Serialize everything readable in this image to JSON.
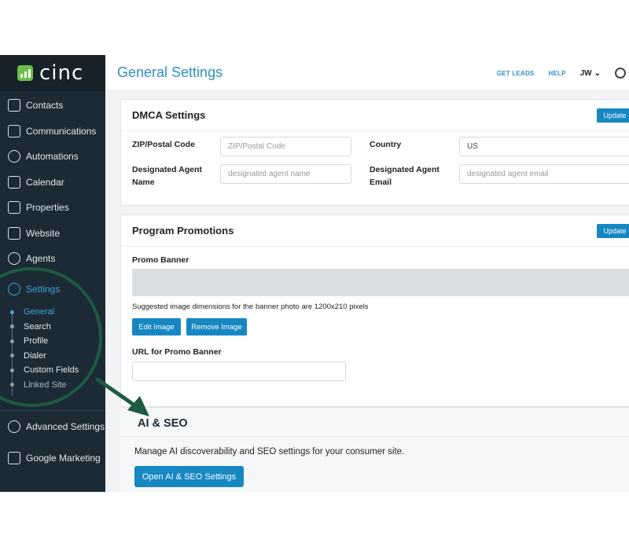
{
  "app": {
    "logo_text": "cinc",
    "brand_color": "#6cc04a",
    "accent": "#1787c2"
  },
  "sidebar": {
    "items": [
      {
        "label": "Contacts",
        "icon": "contacts-icon"
      },
      {
        "label": "Communications",
        "icon": "inbox-icon"
      },
      {
        "label": "Automations",
        "icon": "robot-icon"
      },
      {
        "label": "Calendar",
        "icon": "calendar-icon"
      },
      {
        "label": "Properties",
        "icon": "house-icon"
      },
      {
        "label": "Website",
        "icon": "browser-icon"
      },
      {
        "label": "Agents",
        "icon": "at-icon"
      },
      {
        "label": "Settings",
        "icon": "gear-icon"
      }
    ],
    "subitems": [
      "General",
      "Search",
      "Profile",
      "Dialer",
      "Custom Fields",
      "Linked Site"
    ],
    "bottom": [
      {
        "label": "Advanced Settings",
        "icon": "gears-icon"
      },
      {
        "label": "Google Marketing",
        "icon": "bar-chart-icon"
      }
    ]
  },
  "header": {
    "title": "General Settings",
    "links": [
      "GET LEADS",
      "HELP"
    ],
    "user": "JW"
  },
  "dmca": {
    "title": "DMCA Settings",
    "update_label": "Update",
    "zip_label": "ZIP/Postal Code",
    "zip_placeholder": "ZIP/Postal Code",
    "country_label": "Country",
    "country_value": "US",
    "agent_name_label_1": "Designated Agent",
    "agent_name_label_2": "Name",
    "agent_name_placeholder": "designated agent name",
    "agent_email_label_1": "Designated Agent",
    "agent_email_label_2": "Email",
    "agent_email_placeholder": "designated agent email"
  },
  "promotions": {
    "title": "Program Promotions",
    "update_label": "Update",
    "banner_label": "Promo Banner",
    "note": "Suggested image dimensions for the banner photo are 1200x210 pixels",
    "edit_label": "Edit Image",
    "remove_label": "Remove Image",
    "url_label": "URL for Promo Banner",
    "url_value": ""
  },
  "aiseo": {
    "title": "AI & SEO",
    "description": "Manage AI discoverability and SEO settings for your consumer site.",
    "button_label": "Open AI & SEO Settings"
  }
}
